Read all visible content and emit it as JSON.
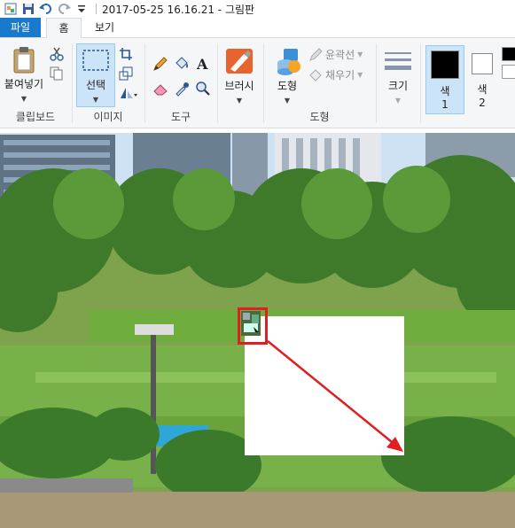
{
  "window": {
    "title": "2017-05-25 16.16.21 - 그림판"
  },
  "quick_access": {
    "icons": [
      "app-icon",
      "save-icon",
      "undo-icon",
      "redo-icon",
      "customize-dropdown-icon"
    ]
  },
  "tabs": {
    "file": "파일",
    "home": "홈",
    "view": "보기"
  },
  "ribbon": {
    "clipboard": {
      "paste": "붙여넣기",
      "group_label": "클립보드"
    },
    "image": {
      "select": "선택",
      "group_label": "이미지"
    },
    "tools": {
      "group_label": "도구"
    },
    "brushes": {
      "label": "브러시"
    },
    "shapes": {
      "shapes": "도형",
      "outline": "윤곽선",
      "fill": "채우기",
      "group_label": "도형"
    },
    "size": {
      "label": "크기"
    },
    "colors": {
      "color1": "색",
      "color1_num": "1",
      "color2": "색",
      "color2_num": "2",
      "color1_value": "#000000",
      "color2_value": "#ffffff"
    }
  },
  "annotation": {
    "highlight_color": "#e02020",
    "arrow_color": "#e02020"
  }
}
